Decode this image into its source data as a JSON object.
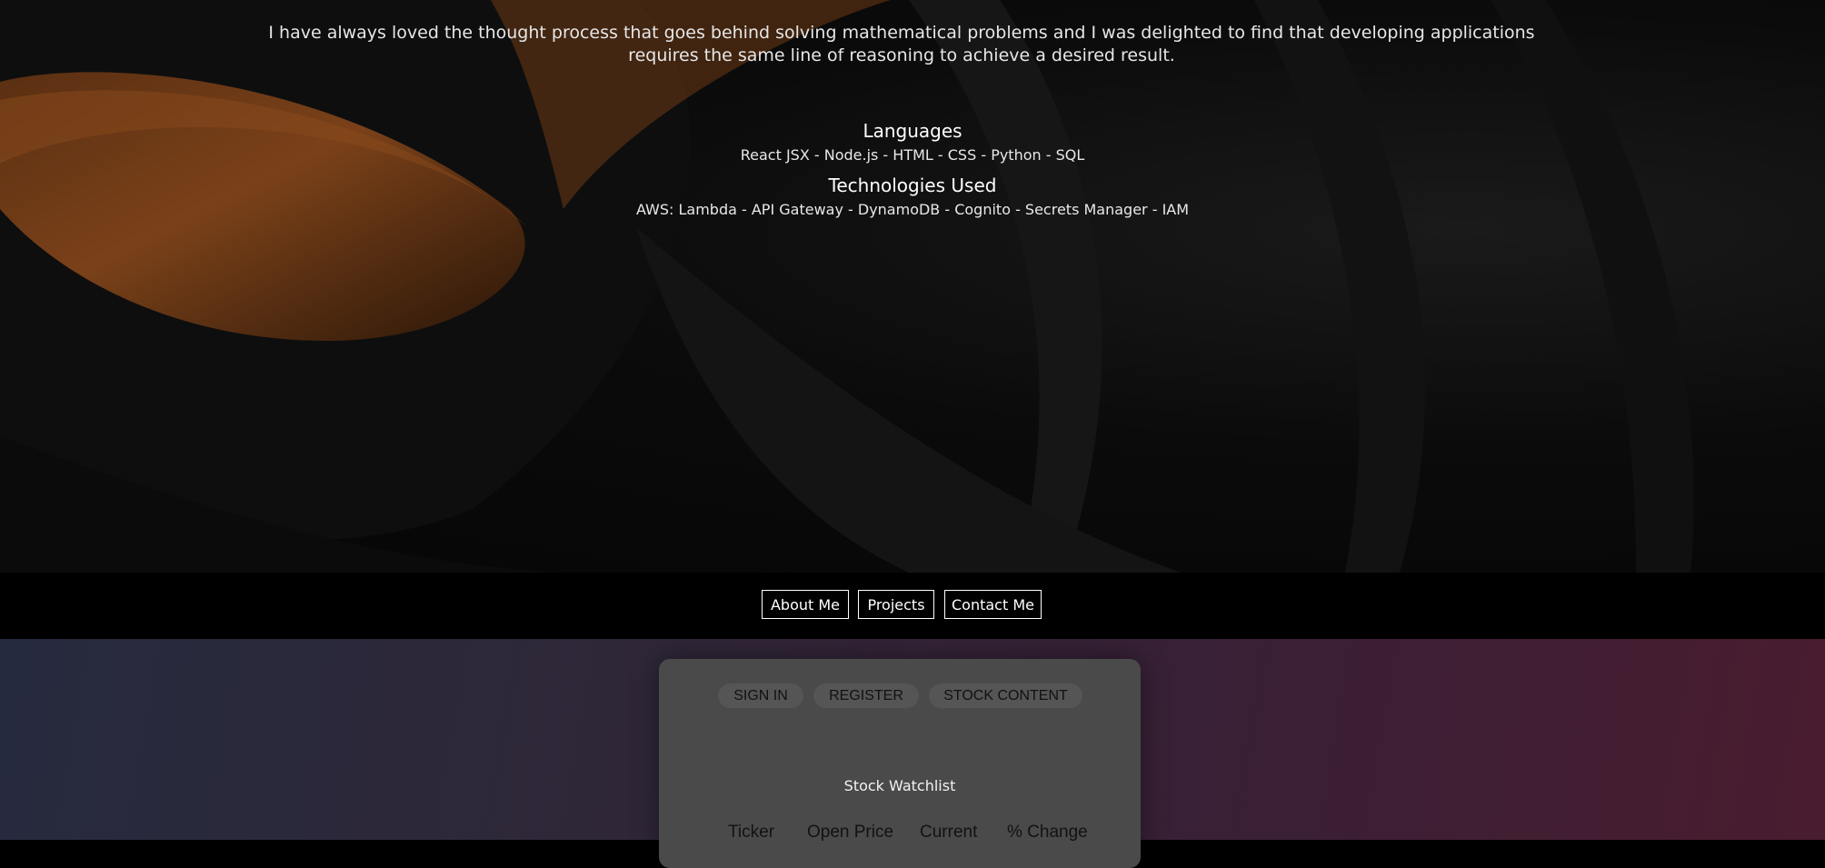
{
  "intro": {
    "text": "I have always loved the thought process that goes behind solving mathematical problems and I was delighted to find that developing applications requires the same line of reasoning to achieve a desired result."
  },
  "languages": {
    "title": "Languages",
    "list": "React JSX - Node.js - HTML - CSS - Python - SQL"
  },
  "technologies": {
    "title": "Technologies Used",
    "list": "AWS: Lambda - API Gateway - DynamoDB - Cognito - Secrets Manager - IAM"
  },
  "nav": {
    "about": "About Me",
    "projects": "Projects",
    "contact": "Contact Me"
  },
  "widget": {
    "tabs": {
      "sign_in": "SIGN IN",
      "register": "REGISTER",
      "stock_content": "STOCK CONTENT"
    },
    "title": "Stock Watchlist",
    "columns": [
      "Ticker",
      "Open Price",
      "Current",
      "% Change"
    ]
  },
  "colors": {
    "accent_orange": "#8a4a1c",
    "nav_border": "#ffffff",
    "card_bg": "#4a4a4a"
  }
}
